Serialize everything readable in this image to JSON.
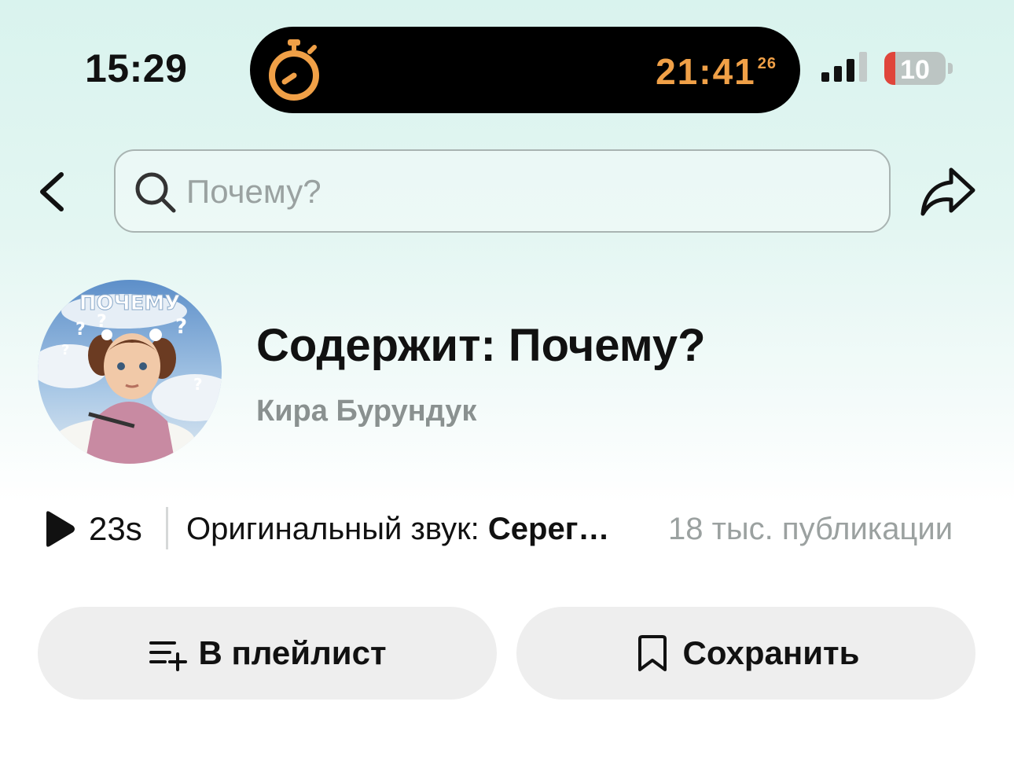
{
  "status_bar": {
    "time": "15:29",
    "timer_main": "21:41",
    "timer_seconds": "26",
    "battery_level": "10",
    "colors": {
      "timer": "#f0a047",
      "battery_low": "#e0453b"
    },
    "icons": [
      "stopwatch-icon",
      "cellular-signal-icon",
      "battery-icon"
    ]
  },
  "nav": {
    "search_placeholder": "Почему?",
    "icons": [
      "chevron-left-icon",
      "search-icon",
      "share-icon"
    ]
  },
  "header": {
    "title": "Содержит: Почему?",
    "author": "Кира Бурундук",
    "avatar_alt": "avatar-image"
  },
  "sound_info": {
    "duration": "23s",
    "sound_prefix": "Оригинальный звук:",
    "sound_name": "Серег…",
    "publications": "18 тыс. публикации"
  },
  "actions": {
    "playlist_label": "В плейлист",
    "save_label": "Сохранить",
    "icons": [
      "playlist-add-icon",
      "bookmark-icon"
    ]
  }
}
